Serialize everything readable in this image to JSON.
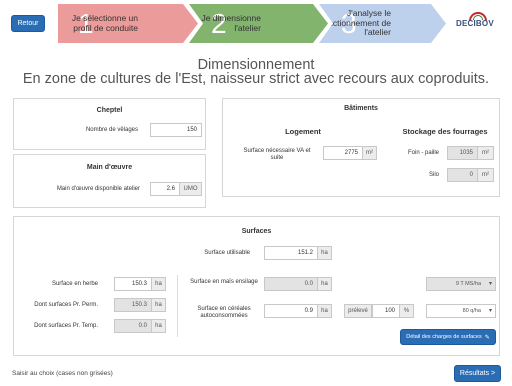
{
  "nav": {
    "back_label": "Retour",
    "results_label": "Résultats >"
  },
  "steps": [
    {
      "num": "1",
      "label": "Je sélectionne un profil de conduite"
    },
    {
      "num": "2",
      "label": "Je dimensionne l'atelier"
    },
    {
      "num": "3",
      "label": "J'analyse le fonctionnement de l'atelier"
    }
  ],
  "logo": {
    "text": "DECIBOV"
  },
  "page": {
    "title": "Dimensionnement",
    "subtitle": "En zone de cultures de l'Est, naisseur strict avec recours aux coproduits."
  },
  "cheptel": {
    "header": "Cheptel",
    "velages_label": "Nombre de vêlages",
    "velages_value": "150"
  },
  "main_oeuvre": {
    "header": "Main d'œuvre",
    "label": "Main d'œuvre disponible atelier",
    "value": "2.6",
    "unit": "UMO"
  },
  "batiments": {
    "header": "Bâtiments",
    "logement": {
      "header": "Logement",
      "label": "Surface nécessaire VA et suite",
      "value": "2775",
      "unit": "m²"
    },
    "stockage": {
      "header": "Stockage des fourrages",
      "foin_label": "Foin - paille",
      "foin_value": "1035",
      "foin_unit": "m²",
      "silo_label": "Silo",
      "silo_value": "0",
      "silo_unit": "m²"
    }
  },
  "surfaces": {
    "header": "Surfaces",
    "utilisable_label": "Surface utilisable",
    "utilisable_value": "151.2",
    "utilisable_unit": "ha",
    "herbe_label": "Surface en herbe",
    "herbe_value": "150.3",
    "herbe_unit": "ha",
    "pr_perm_label": "Dont surfaces Pr. Perm.",
    "pr_perm_value": "150.3",
    "pr_perm_unit": "ha",
    "pr_temp_label": "Dont surfaces Pr. Temp.",
    "pr_temp_value": "0.0",
    "pr_temp_unit": "ha",
    "mais_label": "Surface en maïs ensilage",
    "mais_value": "0.0",
    "mais_unit": "ha",
    "mais_select": "9 T MS/ha",
    "cereales_label": "Surface en céréales autoconsommées",
    "cereales_value": "0.9",
    "cereales_unit": "ha",
    "preleve_label": "prélevé",
    "preleve_value": "100",
    "preleve_unit": "%",
    "cereales_select": "80 q/ha",
    "detail_button": "Détail des charges de surfaces"
  },
  "footer": {
    "hint": "Saisir au choix (cases non grisées)"
  },
  "colors": {
    "primary": "#2a6db5",
    "step1": "#eb9b99",
    "step2": "#82b46e",
    "step3": "#bdd0ec"
  }
}
